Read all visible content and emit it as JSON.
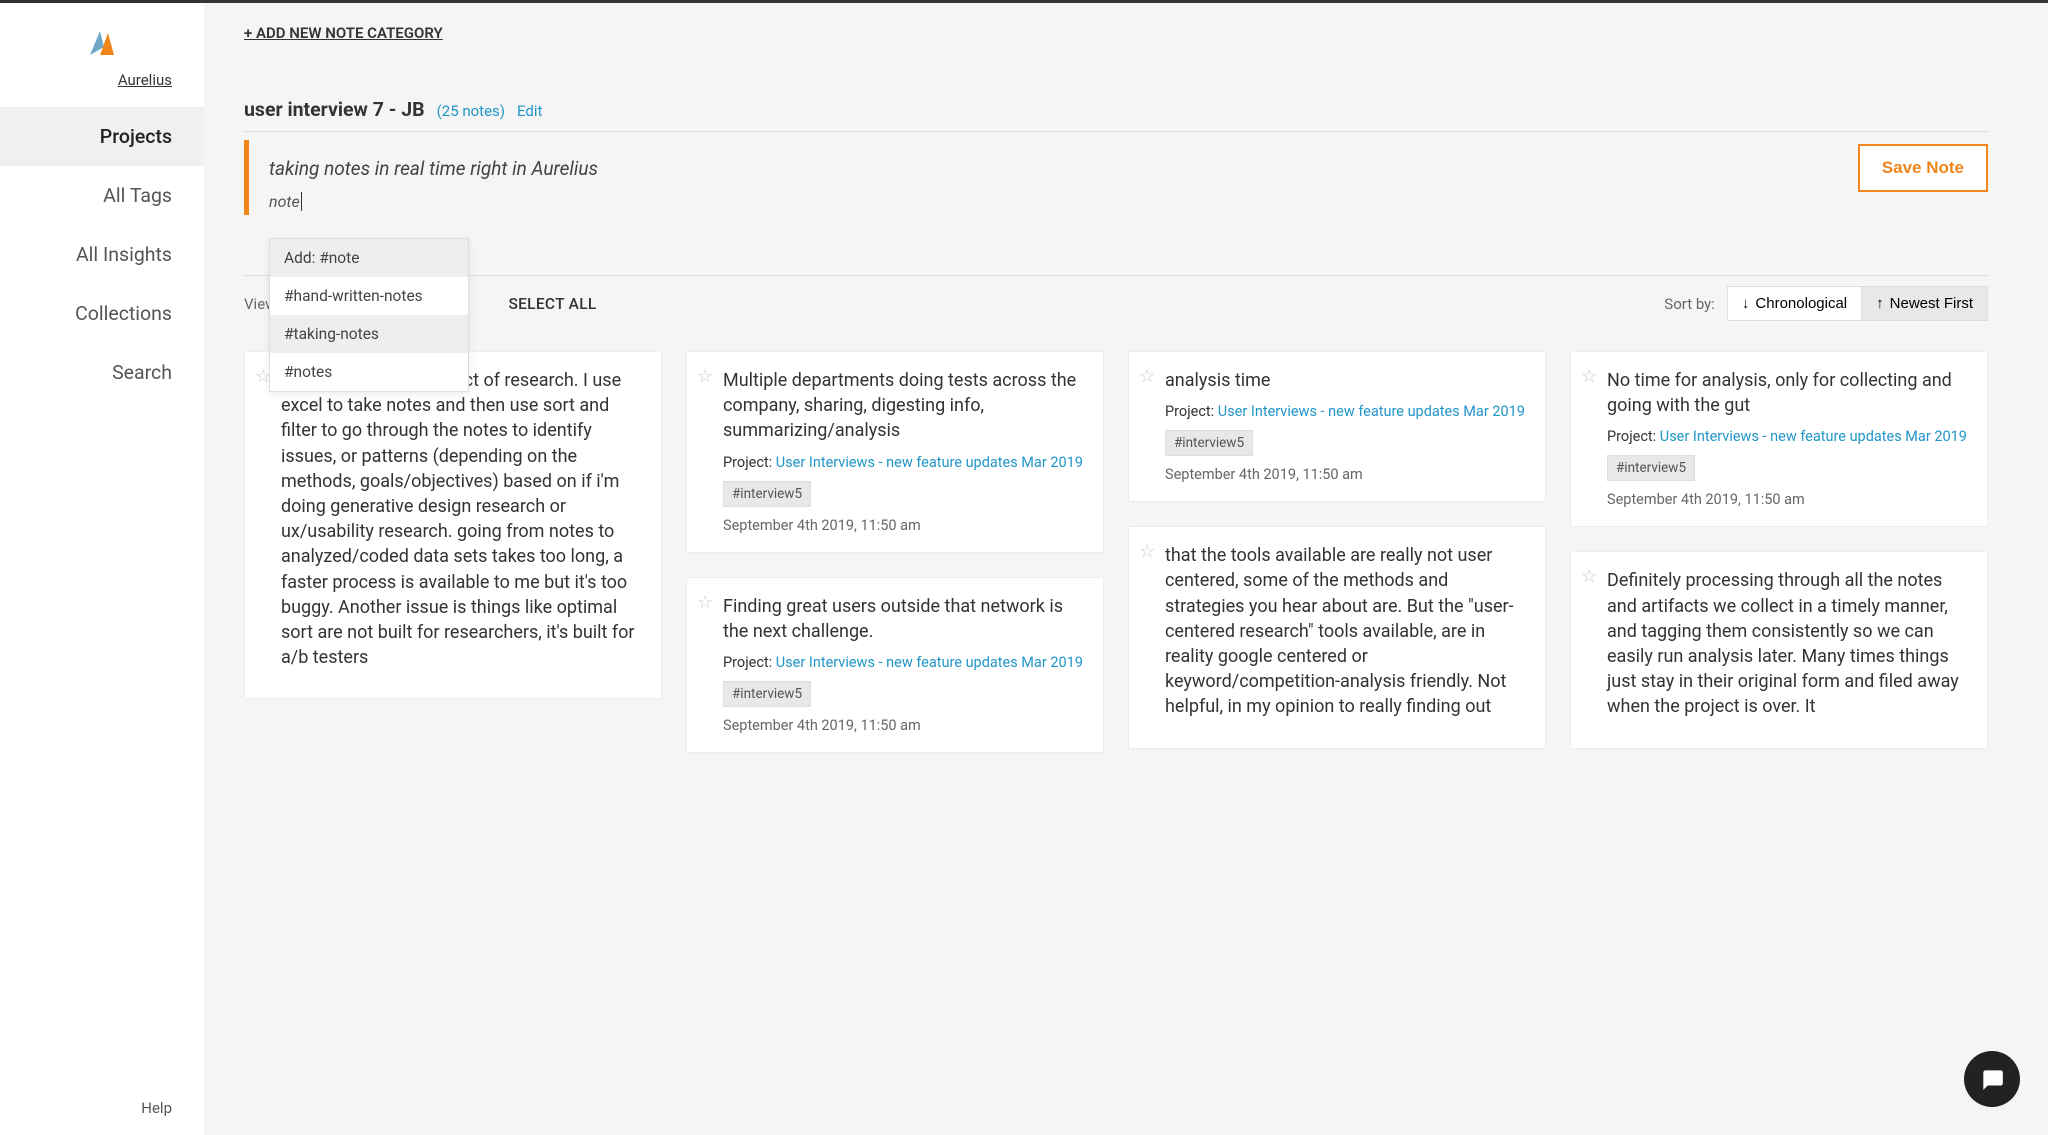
{
  "brand": "Aurelius",
  "nav": {
    "projects": "Projects",
    "tags": "All Tags",
    "insights": "All Insights",
    "collections": "Collections",
    "search": "Search"
  },
  "help": "Help",
  "add_category": "+ ADD NEW NOTE CATEGORY",
  "category": {
    "title": "user interview 7 - JB",
    "count": "(25 notes)",
    "edit": "Edit"
  },
  "compose": {
    "text": "taking notes in real time right in Aurelius",
    "save": "Save Note",
    "tag_input": "note"
  },
  "dropdown": {
    "add": "Add: #note",
    "opt1": "#hand-written-notes",
    "opt2": "#taking-notes",
    "opt3": "#notes"
  },
  "toolbar": {
    "view": "View",
    "select_all": "SELECT ALL",
    "sort_by": "Sort by:",
    "chrono": "Chronological",
    "newest": "Newest First"
  },
  "project_label": "Project: ",
  "project_name": "User Interviews - new feature updates Mar 2019",
  "tag_chip": "#interview5",
  "ts": "September 4th 2019, 11:50 am",
  "notes": {
    "n1": "t time consuming aspect of research. I use excel to take notes and then use sort and filter to go through the notes to identify issues, or patterns (depending on the methods, goals/objectives) based on if i'm doing generative design research or ux/usability research. going from notes to analyzed/coded data sets takes too long, a faster process is available to me but it's too buggy. Another issue is things like optimal sort are not built for researchers, it's built for a/b testers",
    "n2": "Multiple departments doing tests across the company, sharing, digesting info, summarizing/analysis",
    "n3": "Finding great users outside that network is the next challenge.",
    "n4": "analysis time",
    "n5": "that the tools available are really not user centered, some of the methods and strategies you hear about are. But the \"user-centered research\" tools available, are in reality google centered or keyword/competition-analysis friendly. Not helpful, in my opinion to really finding out",
    "n6": "No time for analysis, only for collecting and going with the gut",
    "n7": "Definitely processing through all the notes and artifacts we collect in a timely manner, and tagging them consistently so we can easily run analysis later. Many times things just stay in their original form and filed away when the project is over. It"
  }
}
